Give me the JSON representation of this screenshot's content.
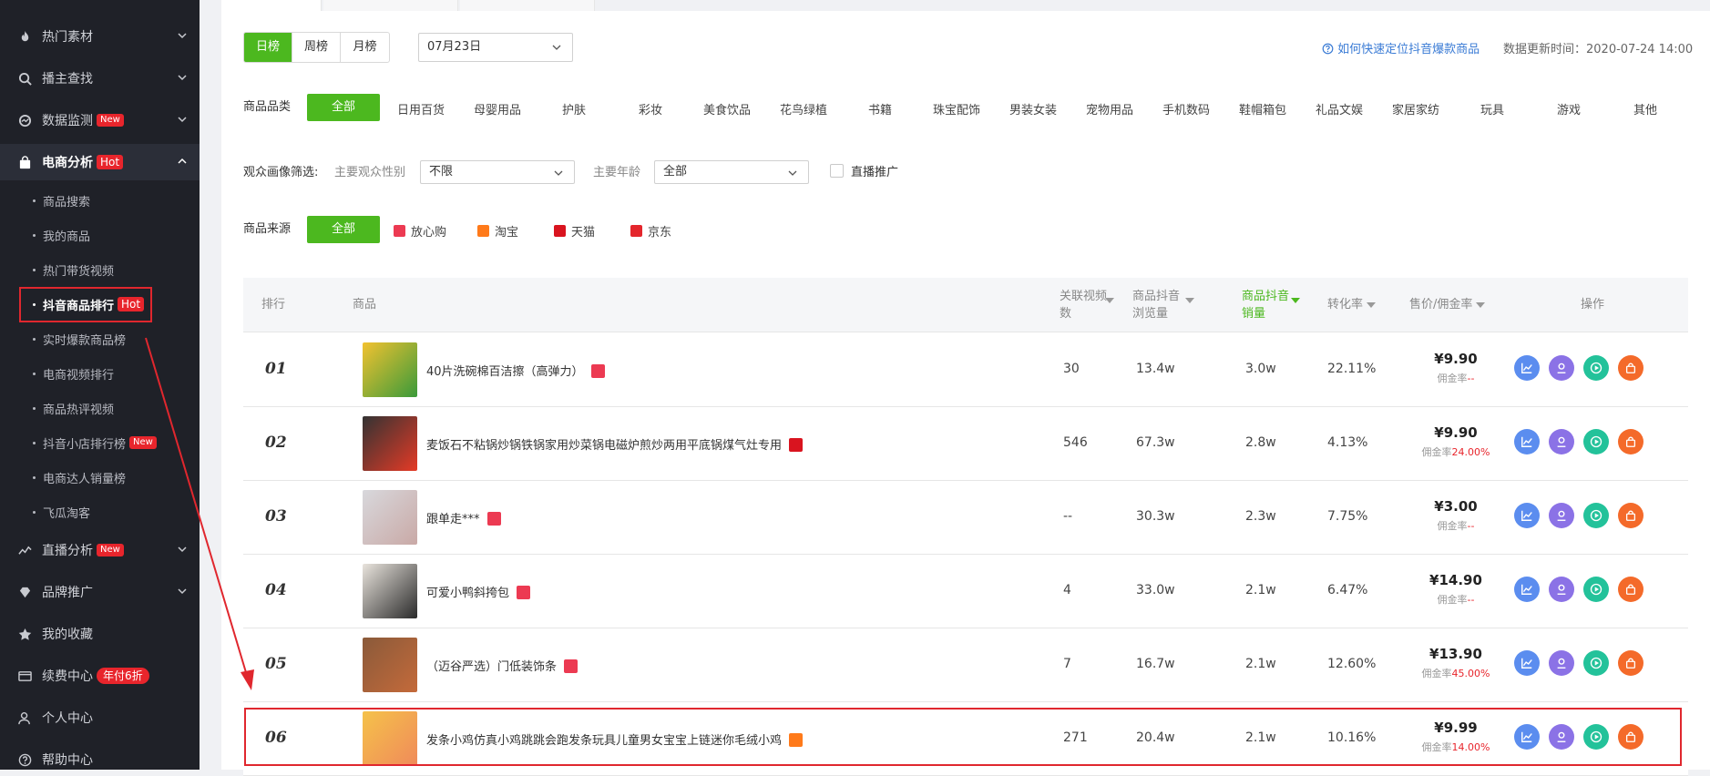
{
  "sidebar": {
    "items": [
      {
        "label": "热门素材",
        "icon": "fire-icon"
      },
      {
        "label": "播主查找",
        "icon": "search-icon"
      },
      {
        "label": "数据监测",
        "icon": "monitor-icon",
        "badge": "New"
      },
      {
        "label": "电商分析",
        "icon": "shopping-bag-icon",
        "badge": "Hot"
      }
    ],
    "sub_items": [
      {
        "label": "商品搜索"
      },
      {
        "label": "我的商品"
      },
      {
        "label": "热门带货视频"
      },
      {
        "label": "抖音商品排行",
        "badge": "Hot"
      },
      {
        "label": "实时爆款商品榜"
      },
      {
        "label": "电商视频排行"
      },
      {
        "label": "商品热评视频"
      },
      {
        "label": "抖音小店排行榜",
        "badge": "New"
      },
      {
        "label": "电商达人销量榜"
      },
      {
        "label": "飞瓜淘客"
      }
    ],
    "bottom_items": [
      {
        "label": "直播分析",
        "icon": "chart-line-icon",
        "badge": "New"
      },
      {
        "label": "品牌推广",
        "icon": "diamond-icon"
      },
      {
        "label": "我的收藏",
        "icon": "star-icon"
      },
      {
        "label": "续费中心",
        "icon": "card-icon",
        "badge": "年付6折"
      },
      {
        "label": "个人中心",
        "icon": "user-icon"
      },
      {
        "label": "帮助中心",
        "icon": "help-icon"
      }
    ]
  },
  "toolbar": {
    "period_tabs": [
      "日榜",
      "周榜",
      "月榜"
    ],
    "date_value": "07月23日",
    "help_link": "如何快速定位抖音爆款商品",
    "update_time": "数据更新时间：2020-07-24 14:00"
  },
  "filters": {
    "category_label": "商品品类",
    "categories": [
      "全部",
      "日用百货",
      "母婴用品",
      "护肤",
      "彩妆",
      "美食饮品",
      "花鸟绿植",
      "书籍",
      "珠宝配饰",
      "男装女装",
      "宠物用品",
      "手机数码",
      "鞋帽箱包",
      "礼品文娱",
      "家居家纺",
      "玩具",
      "游戏",
      "其他"
    ],
    "audience_label": "观众画像筛选:",
    "gender_label": "主要观众性别",
    "gender_value": "不限",
    "age_label": "主要年龄",
    "age_value": "全部",
    "live_label": "直播推广",
    "source_label": "商品来源",
    "sources": [
      "全部",
      "放心购",
      "淘宝",
      "天猫",
      "京东"
    ]
  },
  "table": {
    "headers": {
      "rank": "排行",
      "product": "商品",
      "videos": "关联视频数",
      "views": "商品抖音浏览量",
      "sales": "商品抖音销量",
      "conversion": "转化率",
      "price": "售价/佣金率",
      "actions": "操作"
    },
    "rows": [
      {
        "rank": "01",
        "name": "40片洗碗棉百洁擦（高弹力）",
        "source": "放心购",
        "videos": "30",
        "views": "13.4w",
        "sales": "3.0w",
        "conversion": "22.11%",
        "price": "¥9.90",
        "commission_label": "佣金率",
        "commission": "--"
      },
      {
        "rank": "02",
        "name": "麦饭石不粘锅炒锅铁锅家用炒菜锅电磁炉煎炒两用平底锅煤气灶专用",
        "source": "天猫",
        "videos": "546",
        "views": "67.3w",
        "sales": "2.8w",
        "conversion": "4.13%",
        "price": "¥9.90",
        "commission_label": "佣金率",
        "commission": "24.00%"
      },
      {
        "rank": "03",
        "name": "跟单走***",
        "source": "放心购",
        "videos": "--",
        "views": "30.3w",
        "sales": "2.3w",
        "conversion": "7.75%",
        "price": "¥3.00",
        "commission_label": "佣金率",
        "commission": "--"
      },
      {
        "rank": "04",
        "name": "可爱小鸭斜挎包",
        "source": "放心购",
        "videos": "4",
        "views": "33.0w",
        "sales": "2.1w",
        "conversion": "6.47%",
        "price": "¥14.90",
        "commission_label": "佣金率",
        "commission": "--"
      },
      {
        "rank": "05",
        "name": "（迈谷严选）门低装饰条",
        "source": "放心购",
        "videos": "7",
        "views": "16.7w",
        "sales": "2.1w",
        "conversion": "12.60%",
        "price": "¥13.90",
        "commission_label": "佣金率",
        "commission": "45.00%"
      },
      {
        "rank": "06",
        "name": "发条小鸡仿真小鸡跳跳会跑发条玩具儿童男女宝宝上链迷你毛绒小鸡",
        "source": "淘宝",
        "videos": "271",
        "views": "20.4w",
        "sales": "2.1w",
        "conversion": "10.16%",
        "price": "¥9.99",
        "commission_label": "佣金率",
        "commission": "14.00%"
      }
    ]
  },
  "colors": {
    "accent": "#4cb81f",
    "sidebar_bg": "#1f2128",
    "highlight": "#e0272e",
    "link": "#3a7bd5"
  }
}
